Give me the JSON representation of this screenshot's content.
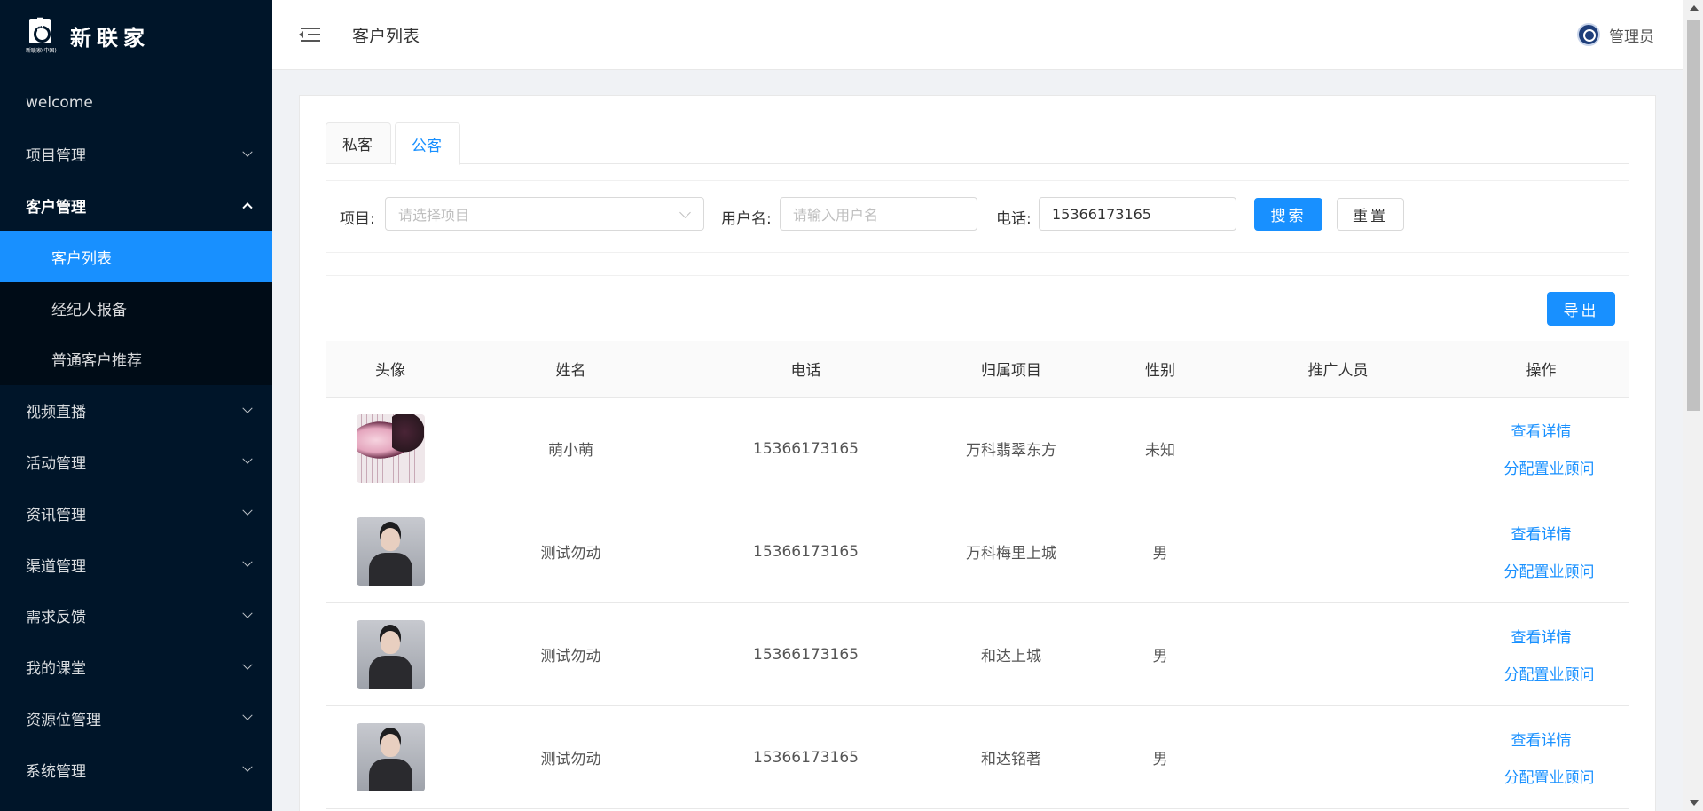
{
  "logo": {
    "mark_letters": "NEW",
    "mark_sub": "新联家(中国)",
    "text": "新联家"
  },
  "sidebar": {
    "items": [
      {
        "label": "welcome"
      },
      {
        "label": "项目管理"
      },
      {
        "label": "客户管理",
        "children": [
          "客户列表",
          "经纪人报备",
          "普通客户推荐"
        ]
      },
      {
        "label": "视频直播"
      },
      {
        "label": "活动管理"
      },
      {
        "label": "资讯管理"
      },
      {
        "label": "渠道管理"
      },
      {
        "label": "需求反馈"
      },
      {
        "label": "我的课堂"
      },
      {
        "label": "资源位管理"
      },
      {
        "label": "系统管理"
      }
    ]
  },
  "header": {
    "title": "客户列表",
    "user": "管理员"
  },
  "tabs": [
    "私客",
    "公客"
  ],
  "filters": {
    "project_label": "项目:",
    "project_placeholder": "请选择项目",
    "username_label": "用户名:",
    "username_placeholder": "请输入用户名",
    "phone_label": "电话:",
    "phone_value": "15366173165",
    "search_btn": "搜索",
    "reset_btn": "重置"
  },
  "export_btn": "导出",
  "table": {
    "columns": [
      "头像",
      "姓名",
      "电话",
      "归属项目",
      "性别",
      "推广人员",
      "操作"
    ],
    "rows": [
      {
        "name": "萌小萌",
        "phone": "15366173165",
        "project": "万科翡翠东方",
        "gender": "未知",
        "promoter": "",
        "detail": "查看详情",
        "assign": "分配置业顾问"
      },
      {
        "name": "测试勿动",
        "phone": "15366173165",
        "project": "万科梅里上城",
        "gender": "男",
        "promoter": "",
        "detail": "查看详情",
        "assign": "分配置业顾问"
      },
      {
        "name": "测试勿动",
        "phone": "15366173165",
        "project": "和达上城",
        "gender": "男",
        "promoter": "",
        "detail": "查看详情",
        "assign": "分配置业顾问"
      },
      {
        "name": "测试勿动",
        "phone": "15366173165",
        "project": "和达铭著",
        "gender": "男",
        "promoter": "",
        "detail": "查看详情",
        "assign": "分配置业顾问"
      }
    ]
  }
}
